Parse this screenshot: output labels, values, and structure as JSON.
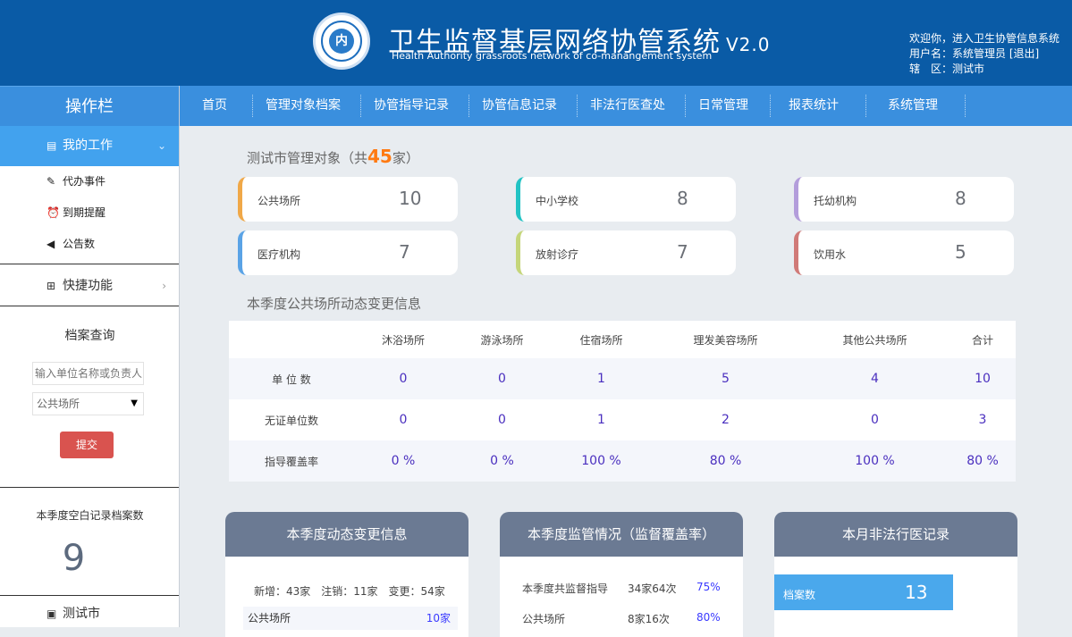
{
  "header": {
    "title": "卫生监督基层网络协管系统",
    "version": "V2.0",
    "subtitle": "Health Authority grassroots network of co-manangement system",
    "logo_text": "内",
    "welcome": "欢迎你，进入卫生协管信息系统",
    "username_line": "用户名：系统管理员",
    "logout": "[退出]",
    "region_line": "辖　区：测试市"
  },
  "sidebar": {
    "title": "操作栏",
    "my_work": "我的工作",
    "sub_items": [
      "代办事件",
      "到期提醒",
      "公告数"
    ],
    "quick": "快捷功能",
    "archive_title": "档案查询",
    "archive_placeholder": "输入单位名称或负责人",
    "archive_select": "公共场所",
    "submit": "提交",
    "blank_title": "本季度空白记录档案数",
    "blank_value": "9",
    "region": "测试市"
  },
  "nav": [
    "首页",
    "管理对象档案",
    "协管指导记录",
    "协管信息记录",
    "非法行医查处",
    "日常管理",
    "报表统计",
    "系统管理"
  ],
  "objects": {
    "title_prefix": "测试市管理对象（共",
    "count": "45",
    "title_suffix": "家）",
    "cards": [
      {
        "label": "公共场所",
        "value": "10",
        "color": "#f0a848"
      },
      {
        "label": "中小学校",
        "value": "8",
        "color": "#22c3c4"
      },
      {
        "label": "托幼机构",
        "value": "8",
        "color": "#b39ddb"
      },
      {
        "label": "医疗机构",
        "value": "7",
        "color": "#5aa3e6"
      },
      {
        "label": "放射诊疗",
        "value": "7",
        "color": "#c5d67a"
      },
      {
        "label": "饮用水",
        "value": "5",
        "color": "#d07a78"
      }
    ]
  },
  "dynamic": {
    "title": "本季度公共场所动态变更信息",
    "headers": [
      "",
      "沐浴场所",
      "游泳场所",
      "住宿场所",
      "理发美容场所",
      "其他公共场所",
      "合计"
    ],
    "rows": [
      {
        "label": "单 位 数",
        "values": [
          "0",
          "0",
          "1",
          "5",
          "4",
          "10"
        ]
      },
      {
        "label": "无证单位数",
        "values": [
          "0",
          "0",
          "1",
          "2",
          "0",
          "3"
        ]
      },
      {
        "label": "指导覆盖率",
        "values": [
          "0 %",
          "0 %",
          "100 %",
          "80 %",
          "100 %",
          "80 %"
        ]
      }
    ]
  },
  "panels": {
    "p1": {
      "title": "本季度动态变更信息",
      "summary": "新增：43家　注销：11家　变更：54家",
      "row_label": "公共场所",
      "row_value": "10家"
    },
    "p2": {
      "title": "本季度监管情况（监督覆盖率）",
      "rows": [
        {
          "a": "本季度共监督指导",
          "b": "34家64次",
          "c": "75%"
        },
        {
          "a": "公共场所",
          "b": "8家16次",
          "c": "80%"
        }
      ]
    },
    "p3": {
      "title": "本月非法行医记录",
      "bar_label": "档案数",
      "bar_value": "13"
    }
  }
}
